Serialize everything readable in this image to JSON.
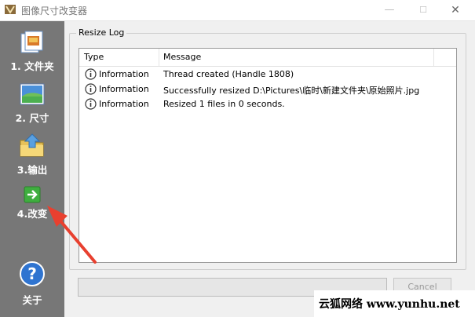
{
  "window": {
    "title": "图像尺寸改变器",
    "minimize_glyph": "—",
    "maximize_glyph": "☐",
    "close_glyph": "✕"
  },
  "sidebar": {
    "items": [
      {
        "label": "1. 文件夹",
        "icon": "folder-documents-icon"
      },
      {
        "label": "2. 尺寸",
        "icon": "image-resize-icon"
      },
      {
        "label": "3.输出",
        "icon": "folder-output-icon"
      },
      {
        "label": "4.改变",
        "icon": "arrow-right-icon"
      },
      {
        "label": "关于",
        "icon": "help-icon"
      }
    ]
  },
  "log": {
    "group_title": "Resize Log",
    "columns": {
      "type": "Type",
      "message": "Message"
    },
    "rows": [
      {
        "type": "Information",
        "message": "Thread created (Handle 1808)"
      },
      {
        "type": "Information",
        "message": "Successfully resized D:\\Pictures\\临时\\新建文件夹\\原始照片.jpg"
      },
      {
        "type": "Information",
        "message": "Resized 1 files in 0 seconds."
      }
    ]
  },
  "bottom": {
    "cancel_label": "Cancel"
  },
  "watermark": {
    "text": "云狐网络 www.yunhu.net"
  },
  "colors": {
    "sidebar": "#777777",
    "annotation_arrow": "#e8402f"
  }
}
